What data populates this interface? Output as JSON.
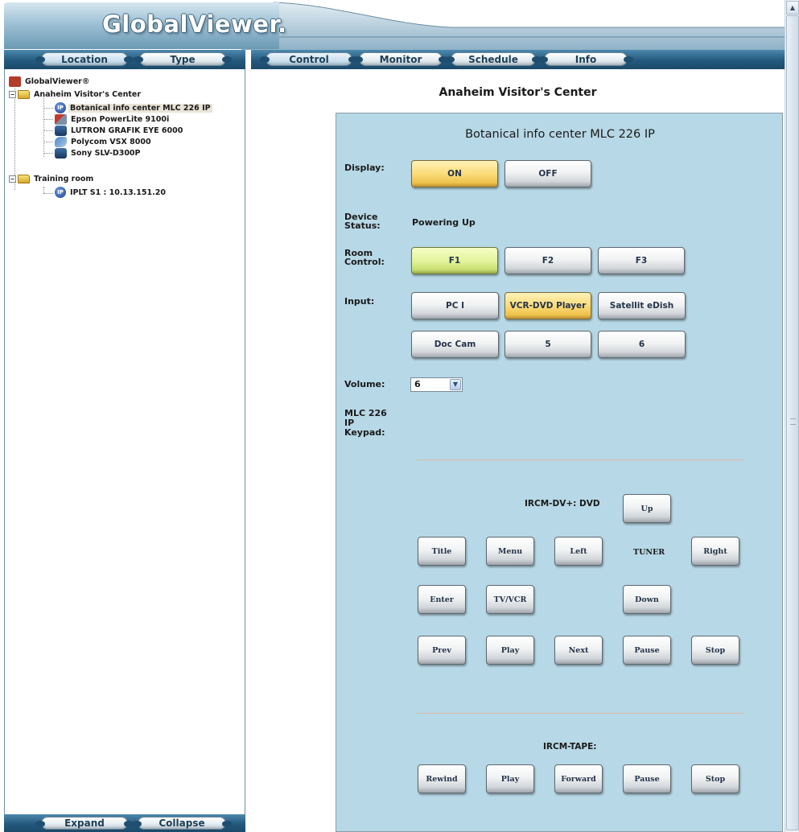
{
  "app": {
    "logo": "GlobalViewer."
  },
  "left_tabs": [
    {
      "label": "Location"
    },
    {
      "label": "Type"
    }
  ],
  "main_tabs": [
    {
      "label": "Control"
    },
    {
      "label": "Monitor"
    },
    {
      "label": "Schedule"
    },
    {
      "label": "Info"
    }
  ],
  "tree": {
    "root": "GlobalViewer®",
    "locations": [
      {
        "label": "Anaheim Visitor's Center",
        "toggle": "−",
        "devices": [
          {
            "label": "Botanical info center MLC 226 IP",
            "icon": "ip-controller-icon"
          },
          {
            "label": "Epson PowerLite 9100i",
            "icon": "projector-icon"
          },
          {
            "label": "LUTRON GRAFIK EYE 6000",
            "icon": "display-icon"
          },
          {
            "label": "Polycom VSX 8000",
            "icon": "videoconference-icon"
          },
          {
            "label": "Sony SLV-D300P",
            "icon": "display-icon"
          }
        ]
      },
      {
        "label": "Training room",
        "toggle": "−",
        "devices": [
          {
            "label": "IPLT S1 : 10.13.151.20",
            "icon": "ip-controller-icon"
          }
        ]
      }
    ]
  },
  "tree_footer": {
    "expand": "Expand",
    "collapse": "Collapse"
  },
  "content": {
    "location_title": "Anaheim Visitor's Center",
    "device_title": "Botanical info center MLC 226 IP",
    "display": {
      "label": "Display:",
      "on": "ON",
      "off": "OFF",
      "state": "ON"
    },
    "status": {
      "label": "Device Status:",
      "value": "Powering Up"
    },
    "room_control": {
      "label": "Room Control:",
      "buttons": [
        "F1",
        "F2",
        "F3"
      ],
      "active": "F1"
    },
    "input": {
      "label": "Input:",
      "buttons": [
        "PC I",
        "VCR-DVD Player",
        "Satellit eDish",
        "Doc Cam",
        "5",
        "6"
      ],
      "active": "VCR-DVD Player"
    },
    "volume": {
      "label": "Volume:",
      "value": "6"
    },
    "keypad": {
      "label": "MLC 226 IP Keypad:"
    },
    "ircm_dvd": {
      "label": "IRCM-DV+: DVD",
      "up": "Up",
      "row1": [
        "Title",
        "Menu",
        "Left"
      ],
      "tuner": "TUNER",
      "right": "Right",
      "row2": [
        "Enter",
        "TV/VCR"
      ],
      "down": "Down",
      "row3": [
        "Prev",
        "Play",
        "Next",
        "Pause",
        "Stop"
      ]
    },
    "ircm_tape": {
      "label": "IRCM-TAPE:",
      "buttons": [
        "Rewind",
        "Play",
        "Forward",
        "Pause",
        "Stop"
      ]
    }
  },
  "colors": {
    "panel_bg": "#b7d8e6",
    "active_orange": "#fbdc7a",
    "active_green": "#e1f29a",
    "bar_blue": "#24597d"
  }
}
